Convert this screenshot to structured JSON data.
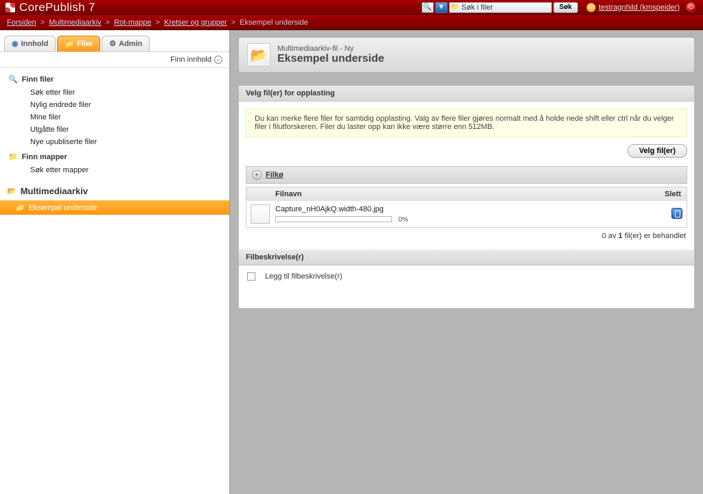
{
  "brand": "CorePublish 7",
  "search": {
    "scope_label": "Søk i filer",
    "button": "Søk"
  },
  "user": {
    "name": "testragnhild (kmspeider)"
  },
  "breadcrumb": {
    "items": [
      "Forsiden",
      "Multimediaarkiv",
      "Rot-mappe",
      "Kretser og grupper"
    ],
    "current": "Eksempel underside"
  },
  "tabs": {
    "innhold": "Innhold",
    "filer": "Filer",
    "admin": "Admin"
  },
  "sidebar": {
    "finn_innhold": "Finn innhold",
    "finn_filer": "Finn filer",
    "finn_filer_items": [
      "Søk etter filer",
      "Nylig endrede filer",
      "Mine filer",
      "Utgåtte filer",
      "Nye upubliserte filer"
    ],
    "finn_mapper": "Finn mapper",
    "finn_mapper_items": [
      "Søk etter mapper"
    ],
    "archive": "Multimediaarkiv",
    "tree_selected": "Eksempel underside"
  },
  "page": {
    "subtitle": "Multimediaarkiv-fil - Ny",
    "title": "Eksempel underside"
  },
  "upload": {
    "section_head": "Velg fil(er) for opplasting",
    "info": "Du kan merke flere filer for samtidig opplasting. Valg av flere filer gjøres normalt med å holde nede shift eller ctrl når du velger filer i filutforskeren. Filer du laster opp kan ikke være større enn 512MB.",
    "button": "Velg fil(er)",
    "filko": "Filkø",
    "columns": {
      "filnavn": "Filnavn",
      "slett": "Slett"
    },
    "files": [
      {
        "name": "Capture_nH0AjkQ.width-480.jpg",
        "progress": "0%"
      }
    ],
    "summary_a": "0 av ",
    "summary_b": "1",
    "summary_c": " fil(er) er behandlet"
  },
  "filedesc": {
    "head": "Filbeskrivelse(r)",
    "add": "Legg til filbeskrivelse(r)"
  }
}
